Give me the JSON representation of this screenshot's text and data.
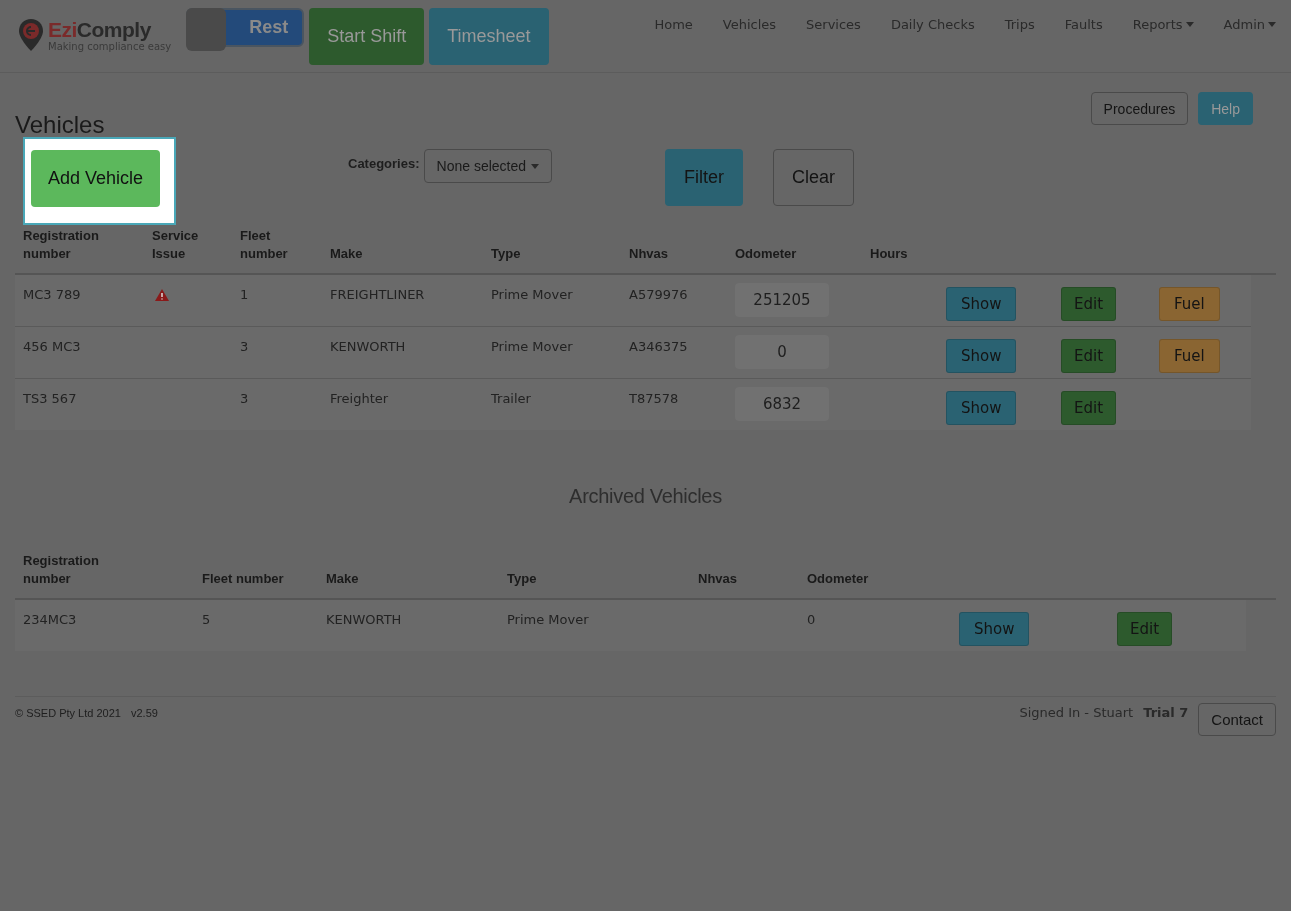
{
  "header": {
    "logo": {
      "name_a": "Ezi",
      "name_b": "Comply",
      "tagline": "Making compliance easy"
    },
    "toggle": {
      "label": "Rest",
      "on": false
    },
    "shift_buttons": [
      {
        "kind": "start",
        "label": "Start Shift"
      },
      {
        "kind": "timesheet",
        "label": "Timesheet"
      }
    ],
    "nav": [
      {
        "label": "Home",
        "dropdown": false
      },
      {
        "label": "Vehicles",
        "dropdown": false
      },
      {
        "label": "Services",
        "dropdown": false
      },
      {
        "label": "Daily Checks",
        "dropdown": false
      },
      {
        "label": "Trips",
        "dropdown": false
      },
      {
        "label": "Faults",
        "dropdown": false
      },
      {
        "label": "Reports",
        "dropdown": true
      },
      {
        "label": "Admin",
        "dropdown": true
      }
    ]
  },
  "page": {
    "title": "Vehicles",
    "top_buttons": [
      {
        "kind": "outline",
        "label": "Procedures"
      },
      {
        "kind": "info",
        "label": "Help"
      }
    ],
    "add_button": {
      "label": "Add Vehicle",
      "highlighted": true
    },
    "filter": {
      "label": "Categories:",
      "select": "None selected",
      "buttons": [
        {
          "kind": "info",
          "label": "Filter"
        },
        {
          "kind": "outline",
          "label": "Clear"
        }
      ]
    }
  },
  "table": {
    "columns": [
      "Registration number",
      "Service Issue",
      "Fleet number",
      "Make",
      "Type",
      "Nhvas",
      "Odometer",
      "Hours"
    ],
    "rows": [
      {
        "registration": "MC3 789",
        "service_issue": true,
        "fleet": "1",
        "make": "FREIGHTLINER",
        "type": "Prime Mover",
        "nhvas": "A579976",
        "odometer": "251205",
        "actions": [
          {
            "kind": "show",
            "label": "Show"
          },
          {
            "kind": "edit",
            "label": "Edit"
          },
          {
            "kind": "fuel",
            "label": "Fuel"
          }
        ]
      },
      {
        "registration": "456 MC3",
        "service_issue": false,
        "fleet": "3",
        "make": "KENWORTH",
        "type": "Prime Mover",
        "nhvas": "A346375",
        "odometer": "0",
        "actions": [
          {
            "kind": "show",
            "label": "Show"
          },
          {
            "kind": "edit",
            "label": "Edit"
          },
          {
            "kind": "fuel",
            "label": "Fuel"
          }
        ]
      },
      {
        "registration": "TS3 567",
        "service_issue": false,
        "fleet": "3",
        "make": "Freighter",
        "type": "Trailer",
        "nhvas": "T87578",
        "odometer": "6832",
        "actions": [
          {
            "kind": "show",
            "label": "Show"
          },
          {
            "kind": "edit",
            "label": "Edit"
          }
        ]
      }
    ]
  },
  "archived": {
    "title": "Archived Vehicles",
    "columns": [
      "Registration number",
      "Fleet number",
      "Make",
      "Type",
      "Nhvas",
      "Odometer"
    ],
    "rows": [
      {
        "registration": "234MC3",
        "fleet": "5",
        "make": "KENWORTH",
        "type": "Prime Mover",
        "odometer": "0",
        "actions": [
          {
            "kind": "show",
            "label": "Show"
          },
          {
            "kind": "edit",
            "label": "Edit"
          }
        ]
      }
    ]
  },
  "footer": {
    "copyright": "© SSED Pty Ltd 2021",
    "version": "v2.59",
    "signed_in": "Signed In - Stuart",
    "plan": "Trial 7",
    "contact": "Contact"
  }
}
